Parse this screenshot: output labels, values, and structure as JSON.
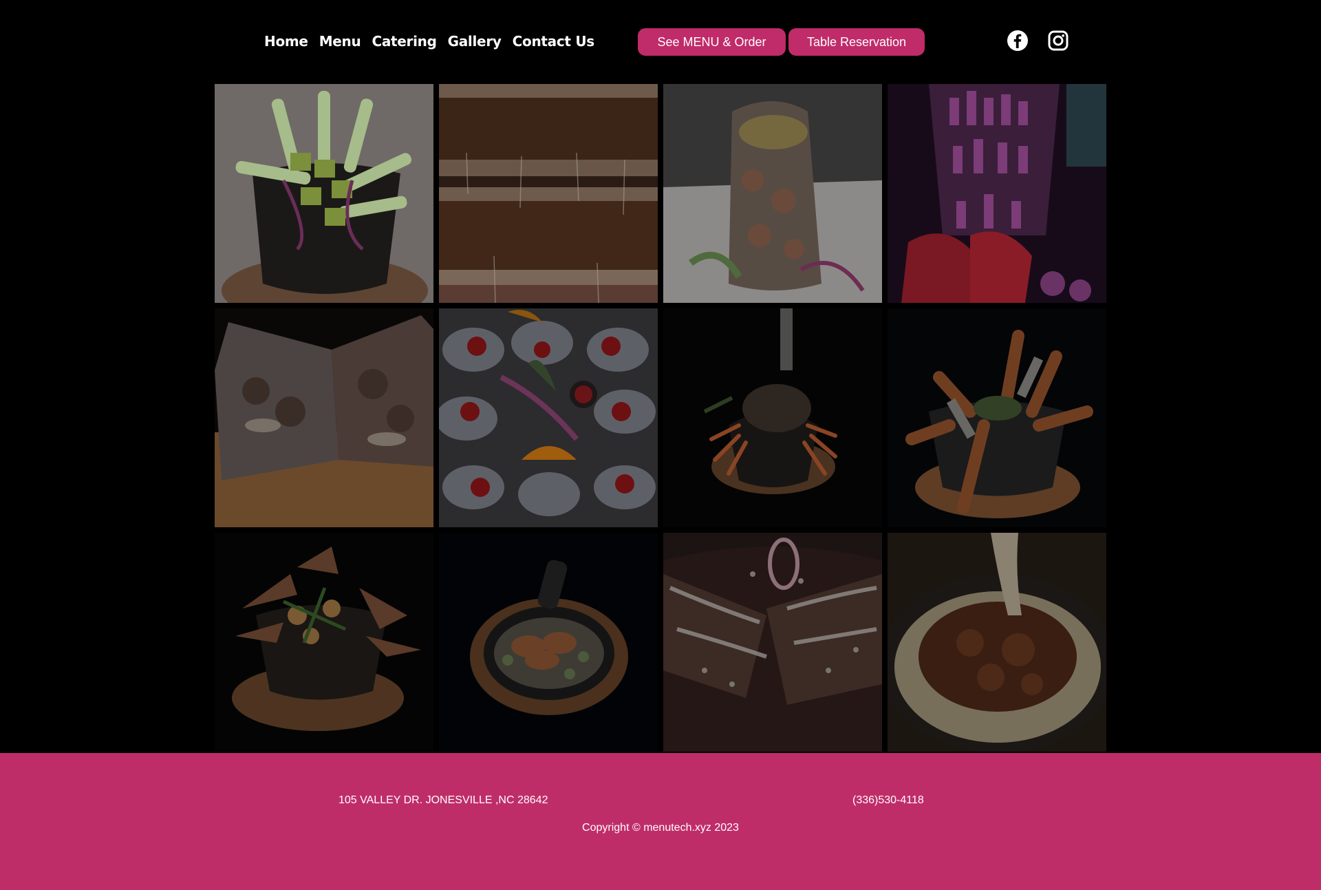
{
  "nav": {
    "items": [
      {
        "label": "Home"
      },
      {
        "label": "Menu"
      },
      {
        "label": "Catering"
      },
      {
        "label": "Gallery"
      },
      {
        "label": "Contact Us"
      }
    ]
  },
  "header": {
    "menu_button_label": "See MENU & Order",
    "reservation_button_label": "Table Reservation",
    "social": [
      {
        "icon": "facebook-icon"
      },
      {
        "icon": "instagram-icon"
      }
    ]
  },
  "gallery": {
    "images": [
      {
        "subject": "molcajete-cucumber-avocado"
      },
      {
        "subject": "stacked-cheese-tortas"
      },
      {
        "subject": "seafood-tower"
      },
      {
        "subject": "bar-bottles"
      },
      {
        "subject": "cheese-tacos-board"
      },
      {
        "subject": "oysters-platter"
      },
      {
        "subject": "crab-molcajete"
      },
      {
        "subject": "fried-shrimp-molcajete"
      },
      {
        "subject": "meat-molcajete"
      },
      {
        "subject": "shrimp-skillet"
      },
      {
        "subject": "mole-enchiladas"
      },
      {
        "subject": "queso-fundido-chorizo"
      }
    ]
  },
  "footer": {
    "address": "105 VALLEY DR. JONESVILLE ,NC 28642",
    "phone": "(336)530-4118",
    "copyright": "Copyright © menutech.xyz 2023"
  },
  "colors": {
    "accent": "#c02b69",
    "background": "#000000",
    "footer_bg": "#bf2d69"
  }
}
